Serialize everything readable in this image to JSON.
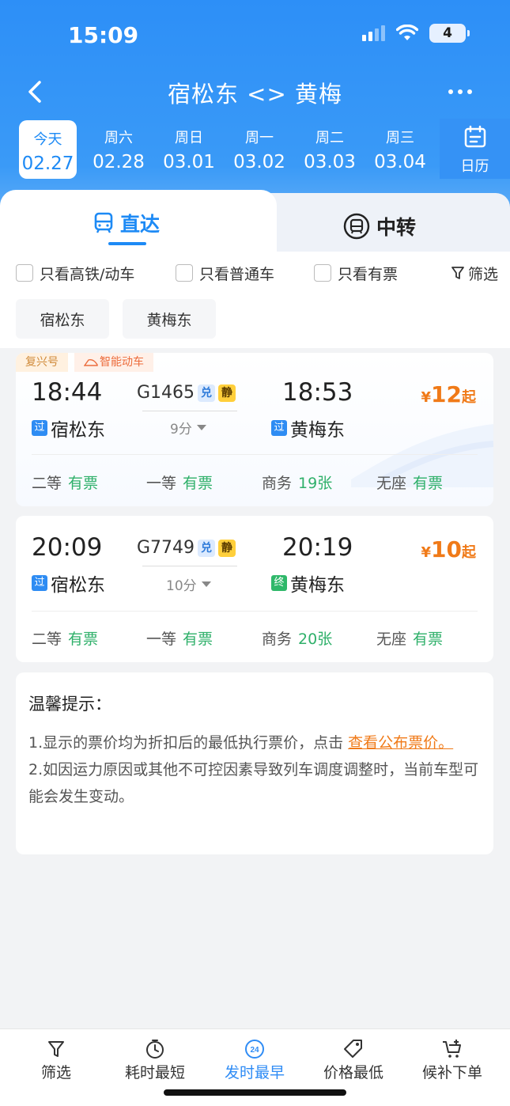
{
  "status": {
    "time": "15:09",
    "battery": "4"
  },
  "nav": {
    "title": "宿松东 <> 黄梅"
  },
  "dates": [
    {
      "weekday": "今天",
      "date": "02.27"
    },
    {
      "weekday": "周六",
      "date": "02.28"
    },
    {
      "weekday": "周日",
      "date": "03.01"
    },
    {
      "weekday": "周一",
      "date": "03.02"
    },
    {
      "weekday": "周二",
      "date": "03.03"
    },
    {
      "weekday": "周三",
      "date": "03.04"
    }
  ],
  "calendar_label": "日历",
  "tabs": {
    "direct": "直达",
    "transfer": "中转"
  },
  "filters": {
    "high_speed": "只看高铁/动车",
    "normal": "只看普通车",
    "available": "只看有票",
    "filter_btn": "筛选"
  },
  "station_chips": [
    "宿松东",
    "黄梅东"
  ],
  "trains": [
    {
      "tags": [
        "复兴号",
        "智能动车"
      ],
      "dep_time": "18:44",
      "train_no": "G1465",
      "badge1": "兑",
      "badge2": "静",
      "duration": "9分",
      "arr_time": "18:53",
      "dep_station": "宿松东",
      "dep_badge": "过",
      "arr_station": "黄梅东",
      "arr_badge": "过",
      "price_symbol": "¥",
      "price": "12",
      "price_suffix": "起",
      "seats": [
        {
          "type": "二等",
          "status": "有票"
        },
        {
          "type": "一等",
          "status": "有票"
        },
        {
          "type": "商务",
          "status": "19张"
        },
        {
          "type": "无座",
          "status": "有票"
        }
      ]
    },
    {
      "tags": [],
      "dep_time": "20:09",
      "train_no": "G7749",
      "badge1": "兑",
      "badge2": "静",
      "duration": "10分",
      "arr_time": "20:19",
      "dep_station": "宿松东",
      "dep_badge": "过",
      "arr_station": "黄梅东",
      "arr_badge": "终",
      "price_symbol": "¥",
      "price": "10",
      "price_suffix": "起",
      "seats": [
        {
          "type": "二等",
          "status": "有票"
        },
        {
          "type": "一等",
          "status": "有票"
        },
        {
          "type": "商务",
          "status": "20张"
        },
        {
          "type": "无座",
          "status": "有票"
        }
      ]
    }
  ],
  "tips": {
    "title": "温馨提示：",
    "line1_prefix": "1.显示的票价均为折扣后的最低执行票价，点击 ",
    "line1_link": "查看公布票价",
    "line1_suffix": "。",
    "line2": "2.如因运力原因或其他不可控因素导致列车调度调整时，当前车型可能会发生变动。"
  },
  "bottom_bar": {
    "filter": "筛选",
    "shortest": "耗时最短",
    "earliest": "发时最早",
    "earliest_icon_text": "24",
    "cheapest": "价格最低",
    "waitlist": "候补下单"
  },
  "colors": {
    "primary": "#2d8ff7",
    "price": "#f07a18",
    "available": "#2fb06a"
  }
}
